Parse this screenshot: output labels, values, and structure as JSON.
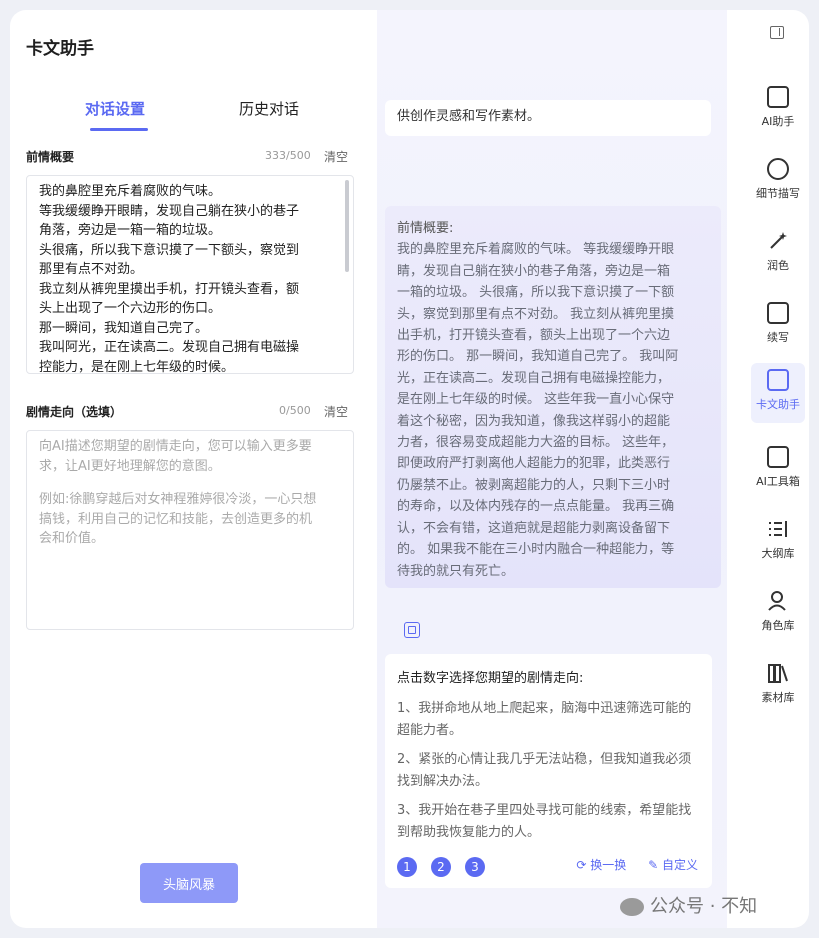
{
  "app": {
    "title": "卡文助手"
  },
  "tabs": [
    {
      "label": "对话设置",
      "active": true
    },
    {
      "label": "历史对话",
      "active": false
    }
  ],
  "previous": {
    "label": "前情概要",
    "count": "333/500",
    "clear": "清空",
    "lines": [
      "我的鼻腔里充斥着腐败的气味。",
      "等我缓缓睁开眼睛，发现自己躺在狭小的巷子",
      "角落，旁边是一箱一箱的垃圾。",
      "头很痛，所以我下意识摸了一下额头，察觉到",
      "那里有点不对劲。",
      "我立刻从裤兜里摸出手机，打开镜头查看，额",
      "头上出现了一个六边形的伤口。",
      "那一瞬间，我知道自己完了。",
      "我叫阿光，正在读高二。发现自己拥有电磁操",
      "控能力，是在刚上七年级的时候。"
    ]
  },
  "plot": {
    "label": "剧情走向（选填）",
    "count": "0/500",
    "clear": "清空",
    "placeholder_lines": [
      "向AI描述您期望的剧情走向，您可以输入更多要",
      "求，让AI更好地理解您的意图。",
      "",
      "例如:徐鹏穿越后对女神程雅婷很冷淡，一心只想",
      "搞钱，利用自己的记忆和技能，去创造更多的机",
      "会和价值。"
    ]
  },
  "brainstorm": "头脑风暴",
  "chat": {
    "top_message": "供创作灵感和写作素材。",
    "context_lines": [
      "前情概要:",
      "我的鼻腔里充斥着腐败的气味。 等我缓缓睁开眼",
      "睛，发现自己躺在狭小的巷子角落，旁边是一箱",
      "一箱的垃圾。 头很痛，所以我下意识摸了一下额",
      "头，察觉到那里有点不对劲。 我立刻从裤兜里摸",
      "出手机，打开镜头查看，额头上出现了一个六边",
      "形的伤口。 那一瞬间，我知道自己完了。 我叫阿",
      "光，正在读高二。发现自己拥有电磁操控能力，",
      "是在刚上七年级的时候。 这些年我一直小心保守",
      "着这个秘密，因为我知道，像我这样弱小的超能",
      "力者，很容易变成超能力大盗的目标。 这些年，",
      "即便政府严打剥离他人超能力的犯罪，此类恶行",
      "仍屡禁不止。被剥离超能力的人，只剩下三小时",
      "的寿命，以及体内残存的一点点能量。 我再三确",
      "认，不会有错，这道疤就是超能力剥离设备留下",
      "的。 如果我不能在三小时内融合一种超能力，等",
      "待我的就只有死亡。"
    ],
    "options_title": "点击数字选择您期望的剧情走向:",
    "options": [
      "1、我拼命地从地上爬起来，脑海中迅速筛选可能的超能力者。",
      "2、紧张的心情让我几乎无法站稳，但我知道我必须找到解决办法。",
      "3、我开始在巷子里四处寻找可能的线索，希望能找到帮助我恢复能力的人。"
    ],
    "option_nums": [
      "1",
      "2",
      "3"
    ],
    "refresh": "换一换",
    "custom": "自定义"
  },
  "sidebar": [
    {
      "label": "AI助手",
      "icon": "ai-assistant-icon"
    },
    {
      "label": "细节描写",
      "icon": "compass-icon"
    },
    {
      "label": "润色",
      "icon": "magic-wand-icon"
    },
    {
      "label": "续写",
      "icon": "continue-doc-icon"
    },
    {
      "label": "卡文助手",
      "icon": "book-helper-icon",
      "active": true
    },
    {
      "label": "AI工具箱",
      "icon": "toolbox-icon"
    },
    {
      "label": "大纲库",
      "icon": "outline-list-icon"
    },
    {
      "label": "角色库",
      "icon": "character-icon"
    },
    {
      "label": "素材库",
      "icon": "books-icon"
    }
  ],
  "watermark": "公众号 · 不知",
  "colors": {
    "accent": "#5b6af2",
    "button": "#8e99f8"
  }
}
